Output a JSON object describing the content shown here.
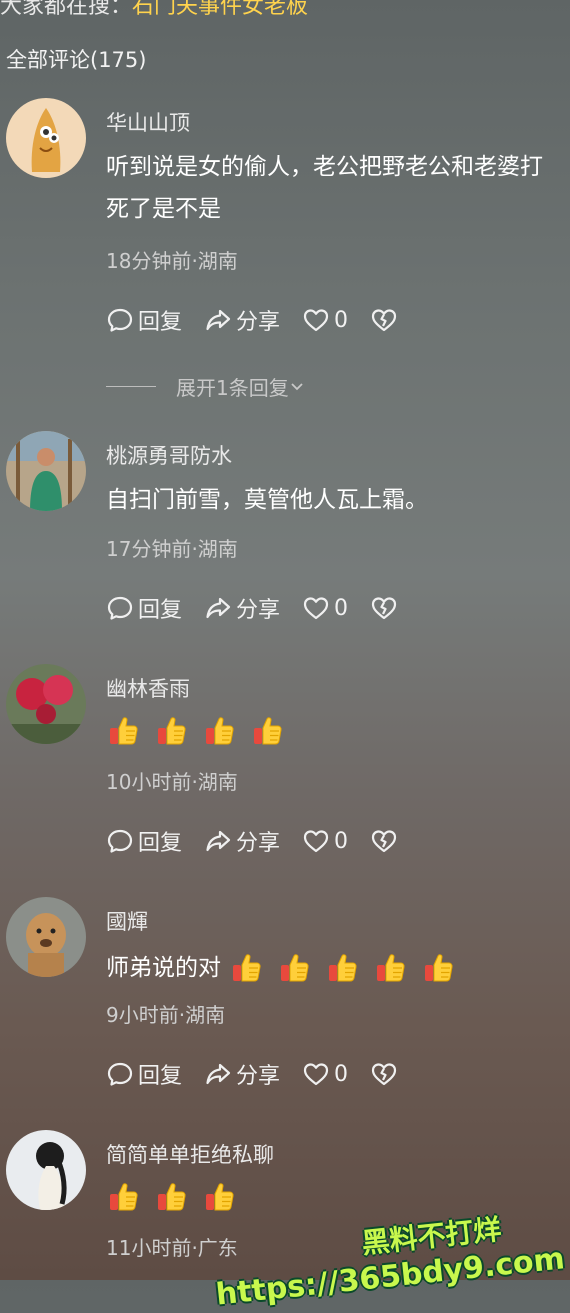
{
  "header": {
    "search_prefix": "大家都在搜：",
    "search_keyword": "石门夫事件女老板",
    "comment_count_label": "全部评论(175)"
  },
  "actions": {
    "reply": "回复",
    "share": "分享"
  },
  "comments": [
    {
      "username": "华山山顶",
      "text_line1": "听到说是女的偷人，老公把野老公和老婆打",
      "text_line2": "死了是不是",
      "meta": "18分钟前·湖南",
      "likes": "0",
      "expand": "展开1条回复"
    },
    {
      "username": "桃源勇哥防水",
      "text_line1": "自扫门前雪，莫管他人瓦上霜。",
      "meta": "17分钟前·湖南",
      "likes": "0"
    },
    {
      "username": "幽林香雨",
      "emoji": "thumbs-up",
      "emoji_count": 4,
      "meta": "10小时前·湖南",
      "likes": "0"
    },
    {
      "username": "國輝",
      "text_line1": "师弟说的对",
      "emoji": "thumbs-up",
      "emoji_count": 5,
      "meta": "9小时前·湖南",
      "likes": "0"
    },
    {
      "username": "简简单单拒绝私聊",
      "emoji": "thumbs-up",
      "emoji_count": 3,
      "meta": "11小时前·广东"
    }
  ],
  "watermark": {
    "line1": "黑料不打烊",
    "line2": "https://365bdy9.com"
  },
  "colors": {
    "keyword": "#ffd34d",
    "watermark": "#c8f84d"
  }
}
